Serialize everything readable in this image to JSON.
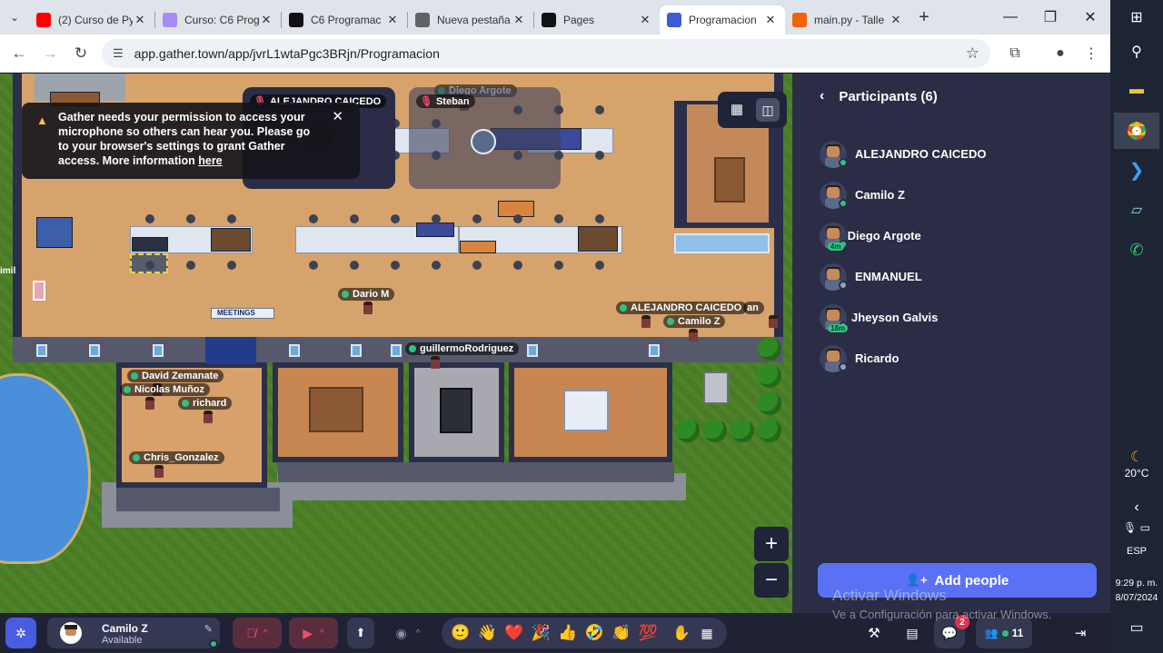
{
  "browser": {
    "tabs": [
      {
        "title": "(2) Curso de Py",
        "icon": "youtube-icon",
        "color": "#ff0000"
      },
      {
        "title": "Curso: C6 Prog",
        "icon": "course-icon",
        "color": "#a78bfa"
      },
      {
        "title": "C6 Programac",
        "icon": "c6-icon",
        "color": "#111111"
      },
      {
        "title": "Nueva pestaña",
        "icon": "chrome-icon",
        "color": "#5f6368"
      },
      {
        "title": "Pages",
        "icon": "github-icon",
        "color": "#111111"
      },
      {
        "title": "Programacion",
        "icon": "gather-icon",
        "color": "#3c5bd6",
        "active": true
      },
      {
        "title": "main.py - Talle",
        "icon": "replit-icon",
        "color": "#f26207"
      }
    ],
    "url": "app.gather.town/app/jvrL1wtaPgc3BRjn/Programacion"
  },
  "notice": {
    "text": "Gather needs your permission to access your microphone so others can hear you. Please go to your browser's settings to grant Gather access. More information",
    "link": "here"
  },
  "video_tiles": [
    {
      "name": "ALEJANDRO CAICEDO",
      "muted": true
    },
    {
      "name": "Steban",
      "muted": true
    }
  ],
  "map_labels": [
    {
      "name": "Diego Argote"
    },
    {
      "name": "Dario M"
    },
    {
      "name": "ALEJANDRO CAICEDO"
    },
    {
      "name": "an"
    },
    {
      "name": "Camilo Z"
    },
    {
      "name": "guillermoRodriguez"
    },
    {
      "name": "David Zemanate"
    },
    {
      "name": "Nicolas Muñoz"
    },
    {
      "name": "richard"
    },
    {
      "name": "Chris_Gonzalez"
    }
  ],
  "map_signs": {
    "meetings": "MEETINGS",
    "left_edge": "imil"
  },
  "panel": {
    "title": "Participants (6)",
    "participants": [
      {
        "name": "ALEJANDRO CAICEDO",
        "status": "#2ec27e",
        "tag": ""
      },
      {
        "name": "Camilo Z",
        "status": "#2ec27e",
        "tag": ""
      },
      {
        "name": "Diego Argote",
        "status": "#2ec27e",
        "tag": "4m"
      },
      {
        "name": "ENMANUEL",
        "status": "#9aa0b4",
        "tag": ""
      },
      {
        "name": "Jheyson Galvis",
        "status": "#2ec27e",
        "tag": "18m"
      },
      {
        "name": "Ricardo",
        "status": "#9aa0b4",
        "tag": ""
      }
    ],
    "add_button": "Add people"
  },
  "watermark": {
    "line1": "Activar Windows",
    "line2": "Ve a Configuración para activar Windows."
  },
  "toolbar": {
    "user_name": "Camilo Z",
    "user_status": "Available",
    "emojis": [
      "🙂",
      "👋",
      "❤️",
      "🎉",
      "👍",
      "🤣",
      "👏",
      "💯"
    ],
    "chat_badge": "2",
    "people_count": "11"
  },
  "taskbar": {
    "temperature": "20°C",
    "language": "ESP",
    "time": "9:29 p. m.",
    "date": "8/07/2024"
  }
}
